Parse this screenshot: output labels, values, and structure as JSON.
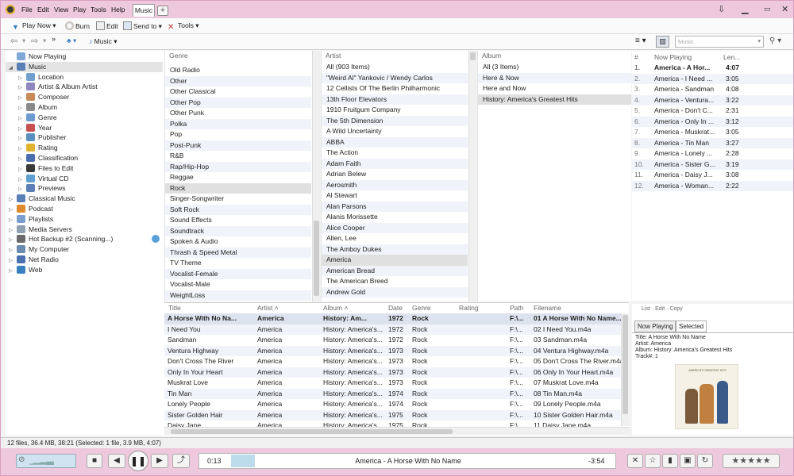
{
  "menu": {
    "items": [
      "File",
      "Edit",
      "View",
      "Play",
      "Tools",
      "Help"
    ],
    "tab_label": "Music",
    "add_tab": "+"
  },
  "toolbar": {
    "play_now": "Play Now",
    "burn": "Burn",
    "edit": "Edit",
    "send_to": "Send to",
    "tools": "Tools"
  },
  "nav": {
    "location": "Music",
    "search_placeholder": "Music"
  },
  "tree": [
    {
      "label": "Now Playing",
      "level": 0,
      "arrow": "",
      "icon_color": "#7fa8d8"
    },
    {
      "label": "Music",
      "level": 0,
      "arrow": "◢",
      "icon_color": "#5b7fb7",
      "selected": true
    },
    {
      "label": "Location",
      "level": 1,
      "arrow": "▷",
      "icon_color": "#6fa0d0"
    },
    {
      "label": "Artist & Album Artist",
      "level": 1,
      "arrow": "▷",
      "icon_color": "#8f86c0"
    },
    {
      "label": "Composer",
      "level": 1,
      "arrow": "▷",
      "icon_color": "#c98a5a"
    },
    {
      "label": "Album",
      "level": 1,
      "arrow": "▷",
      "icon_color": "#8a8a8a"
    },
    {
      "label": "Genre",
      "level": 1,
      "arrow": "▷",
      "icon_color": "#6b9bd1"
    },
    {
      "label": "Year",
      "level": 1,
      "arrow": "▷",
      "icon_color": "#c85050"
    },
    {
      "label": "Publisher",
      "level": 1,
      "arrow": "▷",
      "icon_color": "#5a8fc0"
    },
    {
      "label": "Rating",
      "level": 1,
      "arrow": "▷",
      "icon_color": "#e1b230"
    },
    {
      "label": "Classification",
      "level": 1,
      "arrow": "▷",
      "icon_color": "#4a6db0"
    },
    {
      "label": "Files to Edit",
      "level": 1,
      "arrow": "▷",
      "icon_color": "#3a3a3a"
    },
    {
      "label": "Virtual CD",
      "level": 1,
      "arrow": "▷",
      "icon_color": "#60a0d0"
    },
    {
      "label": "Previews",
      "level": 1,
      "arrow": "▷",
      "icon_color": "#5b7fb7"
    },
    {
      "label": "Classical Music",
      "level": 0,
      "arrow": "▷",
      "icon_color": "#5b7fb7"
    },
    {
      "label": "Podcast",
      "level": 0,
      "arrow": "▷",
      "icon_color": "#e08a30"
    },
    {
      "label": "Playlists",
      "level": 0,
      "arrow": "▷",
      "icon_color": "#7a9fd0"
    },
    {
      "label": "Media Servers",
      "level": 0,
      "arrow": "▷",
      "icon_color": "#8fa0b0"
    },
    {
      "label": "Hot Backup #2 (Scanning...)",
      "level": 0,
      "arrow": "▷",
      "icon_color": "#6a6a6a"
    },
    {
      "label": "My Computer",
      "level": 0,
      "arrow": "▷",
      "icon_color": "#6a8ab0"
    },
    {
      "label": "Net Radio",
      "level": 0,
      "arrow": "▷",
      "icon_color": "#4a70b0"
    },
    {
      "label": "Web",
      "level": 0,
      "arrow": "▷",
      "icon_color": "#3a80c0"
    }
  ],
  "genre_pane": {
    "header": "Genre",
    "items": [
      "Old Radio",
      "Other",
      "Other Classical",
      "Other Pop",
      "Other Punk",
      "Polka",
      "Pop",
      "Post-Punk",
      "R&B",
      "Rap/Hip-Hop",
      "Reggae",
      "Rock",
      "Singer-Songwriter",
      "Soft Rock",
      "Sound Effects",
      "Soundtrack",
      "Spoken & Audio",
      "Thrash & Speed Metal",
      "TV Theme",
      "Vocalist-Female",
      "Vocalist-Male",
      "WeightLoss"
    ],
    "selected": "Rock"
  },
  "artist_pane": {
    "header": "Artist",
    "items": [
      "All (903 Items)",
      "\"Weird Al\" Yankovic / Wendy Carlos",
      "12 Cellists Of The Berlin Philharmonic",
      "13th Floor Elevators",
      "1910 Fruitgum Company",
      "The 5th Dimension",
      "A Wild Uncertainty",
      "ABBA",
      "The Action",
      "Adam Faith",
      "Adrian Belew",
      "Aerosmith",
      "Al Stewart",
      "Alan Parsons",
      "Alanis Morissette",
      "Alice Cooper",
      "Allen, Lee",
      "The Amboy Dukes",
      "America",
      "American Bread",
      "The American Breed",
      "Andrew Gold"
    ],
    "selected": "America"
  },
  "album_pane": {
    "header": "Album",
    "items": [
      "All (3 Items)",
      "Here & Now",
      "Here and Now",
      "History: America's Greatest Hits"
    ],
    "selected": "History: America's Greatest Hits"
  },
  "filelist": {
    "columns": [
      "Title",
      "Artist",
      "Album",
      "Date",
      "Genre",
      "Rating",
      "Path",
      "Filename"
    ],
    "rows": [
      {
        "title": "A Horse With No Na...",
        "artist": "America",
        "album": "History: Am...",
        "date": "1972",
        "genre": "Rock",
        "path": "F:\\...",
        "filename": "01 A Horse With No Name..."
      },
      {
        "title": "I Need You",
        "artist": "America",
        "album": "History: America's...",
        "date": "1972",
        "genre": "Rock",
        "path": "F:\\...",
        "filename": "02 I Need You.m4a"
      },
      {
        "title": "Sandman",
        "artist": "America",
        "album": "History: America's...",
        "date": "1972",
        "genre": "Rock",
        "path": "F:\\...",
        "filename": "03 Sandman.m4a"
      },
      {
        "title": "Ventura Highway",
        "artist": "America",
        "album": "History: America's...",
        "date": "1973",
        "genre": "Rock",
        "path": "F:\\...",
        "filename": "04 Ventura Highway.m4a"
      },
      {
        "title": "Don't Cross The River",
        "artist": "America",
        "album": "History: America's...",
        "date": "1973",
        "genre": "Rock",
        "path": "F:\\...",
        "filename": "05 Don't Cross The River.m4a"
      },
      {
        "title": "Only In Your Heart",
        "artist": "America",
        "album": "History: America's...",
        "date": "1973",
        "genre": "Rock",
        "path": "F:\\...",
        "filename": "06 Only In Your Heart.m4a"
      },
      {
        "title": "Muskrat Love",
        "artist": "America",
        "album": "History: America's...",
        "date": "1973",
        "genre": "Rock",
        "path": "F:\\...",
        "filename": "07 Muskrat Love.m4a"
      },
      {
        "title": "Tin Man",
        "artist": "America",
        "album": "History: America's...",
        "date": "1974",
        "genre": "Rock",
        "path": "F:\\...",
        "filename": "08 Tin Man.m4a"
      },
      {
        "title": "Lonely People",
        "artist": "America",
        "album": "History: America's...",
        "date": "1974",
        "genre": "Rock",
        "path": "F:\\...",
        "filename": "09 Lonely People.m4a"
      },
      {
        "title": "Sister Golden Hair",
        "artist": "America",
        "album": "History: America's...",
        "date": "1975",
        "genre": "Rock",
        "path": "F:\\...",
        "filename": "10 Sister Golden Hair.m4a"
      },
      {
        "title": "Daisy Jane",
        "artist": "America",
        "album": "History: America's...",
        "date": "1975",
        "genre": "Rock",
        "path": "F:\\...",
        "filename": "11 Daisy Jane.m4a"
      }
    ]
  },
  "nowplaying": {
    "columns": [
      "#",
      "Now Playing",
      "Len..."
    ],
    "rows": [
      {
        "n": "1.",
        "title": "America - A Hor...",
        "len": "4:07",
        "bold": true
      },
      {
        "n": "2.",
        "title": "America - I Need ...",
        "len": "3:05"
      },
      {
        "n": "3.",
        "title": "America - Sandman",
        "len": "4:08"
      },
      {
        "n": "4.",
        "title": "America - Ventura...",
        "len": "3:22"
      },
      {
        "n": "5.",
        "title": "America - Don't C...",
        "len": "2:31"
      },
      {
        "n": "6.",
        "title": "America - Only In ...",
        "len": "3:12"
      },
      {
        "n": "7.",
        "title": "America - Muskrat...",
        "len": "3:05"
      },
      {
        "n": "8.",
        "title": "America - Tin Man",
        "len": "3:27"
      },
      {
        "n": "9.",
        "title": "America - Lonely ...",
        "len": "2:28"
      },
      {
        "n": "10.",
        "title": "America - Sister G...",
        "len": "3:19"
      },
      {
        "n": "11.",
        "title": "America - Daisy J...",
        "len": "3:08"
      },
      {
        "n": "12.",
        "title": "America - Woman...",
        "len": "2:22"
      }
    ]
  },
  "info": {
    "tabs": [
      "Now Playing",
      "Selected"
    ],
    "active_tab": "Selected",
    "lines": [
      "Title: A Horse With No Name",
      "Artist: America",
      "Album: History: America's Greatest Hits",
      "Track#: 1"
    ],
    "cover_caption": "AMERICA'S GREATEST HITS"
  },
  "status": "12 files, 36.4 MB, 38:21 (Selected: 1 file, 3.9 MB, 4:07)",
  "player": {
    "elapsed": "0:13",
    "track": "America - A Horse With No Name",
    "remaining": "-3:54",
    "progress": 0.05,
    "rating_stars": "★★★★★"
  },
  "colors": {
    "accent": "#eec8dc",
    "selection": "#e0e0e0",
    "alt_row": "#f0f3f9"
  }
}
